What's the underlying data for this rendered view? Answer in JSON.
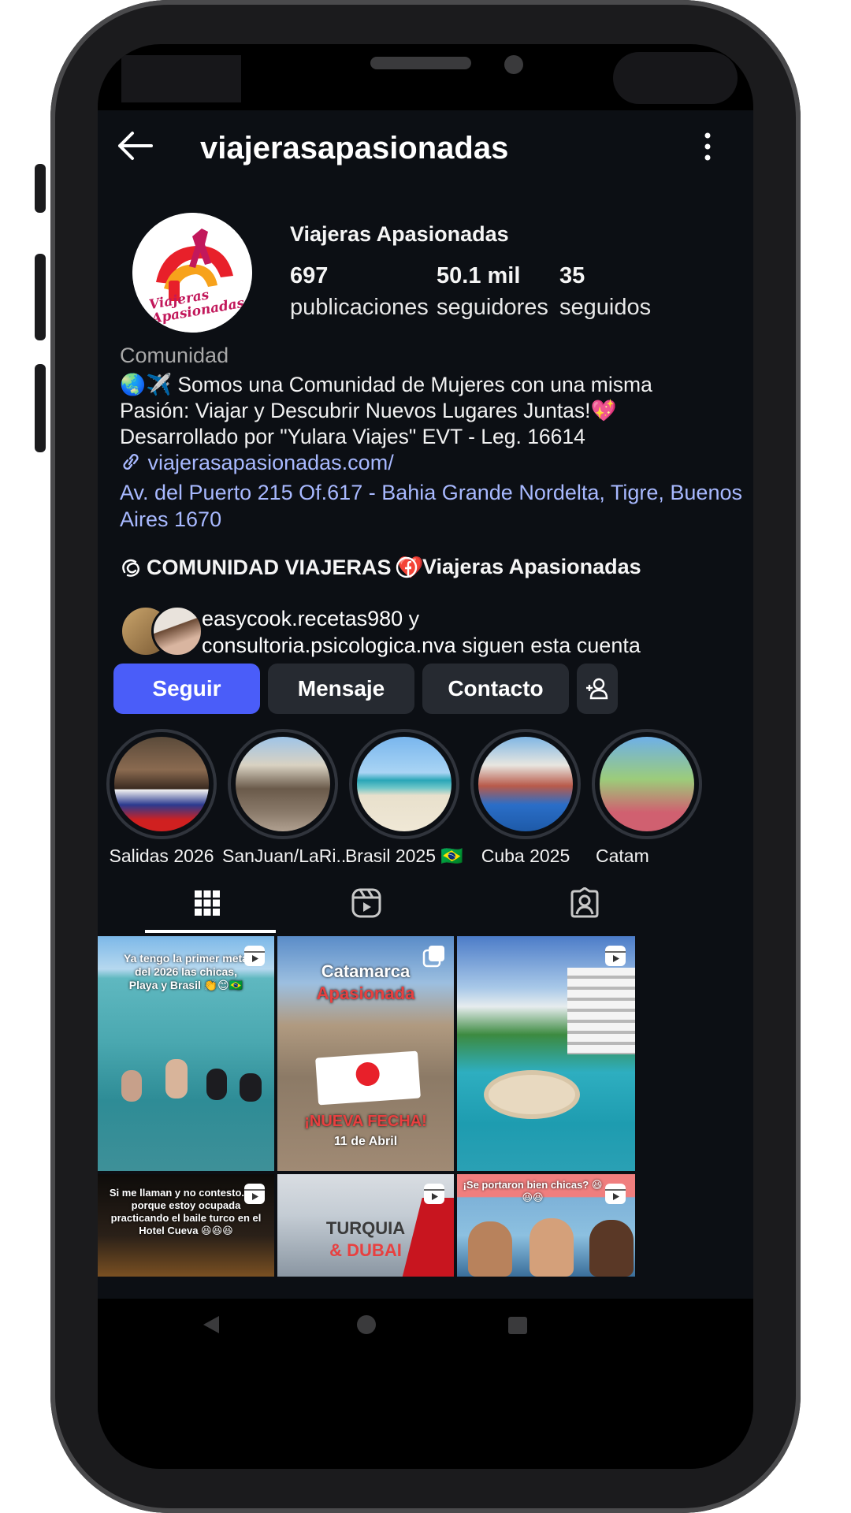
{
  "header": {
    "title": "viajerasapasionadas"
  },
  "profile": {
    "display_name": "Viajeras Apasionadas",
    "stats": [
      {
        "value": "697",
        "label": "publicaciones"
      },
      {
        "value": "50.1 mil",
        "label": "seguidores"
      },
      {
        "value": "35",
        "label": "seguidos"
      }
    ],
    "category": "Comunidad",
    "bio_line1": "🌏✈️ Somos una Comunidad de Mujeres con una misma",
    "bio_line2": "Pasión: Viajar y Descubrir Nuevos Lugares Juntas!💖",
    "bio_line3": "Desarrollado por \"Yulara Viajes\" EVT - Leg. 16614",
    "link": "viajerasapasionadas.com/",
    "address": "Av. del Puerto 215 Of.617 - Bahia Grande Nordelta, Tigre, Buenos Aires 1670",
    "chip_community": "COMUNIDAD VIAJERAS ❤️",
    "chip_facebook": "Viajeras Apasionadas",
    "followed_by_user1": "easycook.recetas980",
    "followed_by_conj": " y",
    "followed_by_user2": "consultoria.psicologica.nva",
    "followed_by_suffix": " siguen esta cuenta"
  },
  "buttons": {
    "follow": "Seguir",
    "message": "Mensaje",
    "contact": "Contacto"
  },
  "highlights": [
    "Salidas 2026",
    "SanJuan/LaRi...",
    "Brasil 2025 🇧🇷",
    "Cuba 2025",
    "Catam"
  ],
  "posts": {
    "p1_text": "Ya tengo la primer meta del 2026 las chicas, Playa y Brasil 👏😊🇧🇷",
    "p2_title1": "Catamarca",
    "p2_title2": "Apasionada",
    "p2_banner": "¡NUEVA FECHA!",
    "p2_date": "11 de Abril",
    "p4_text": "Si me llaman y no contesto.. Es porque estoy ocupada practicando el baile turco en el Hotel Cueva 😆😆😆",
    "p5_text1": "TURQUIA",
    "p5_text2": "& DUBAI",
    "p6_text": "¡Se portaron bien chicas? 😆😆😆"
  },
  "colors": {
    "background": "#0c0f14",
    "accent": "#4a5df9",
    "link": "#a8b9ff",
    "button": "#262a31"
  }
}
